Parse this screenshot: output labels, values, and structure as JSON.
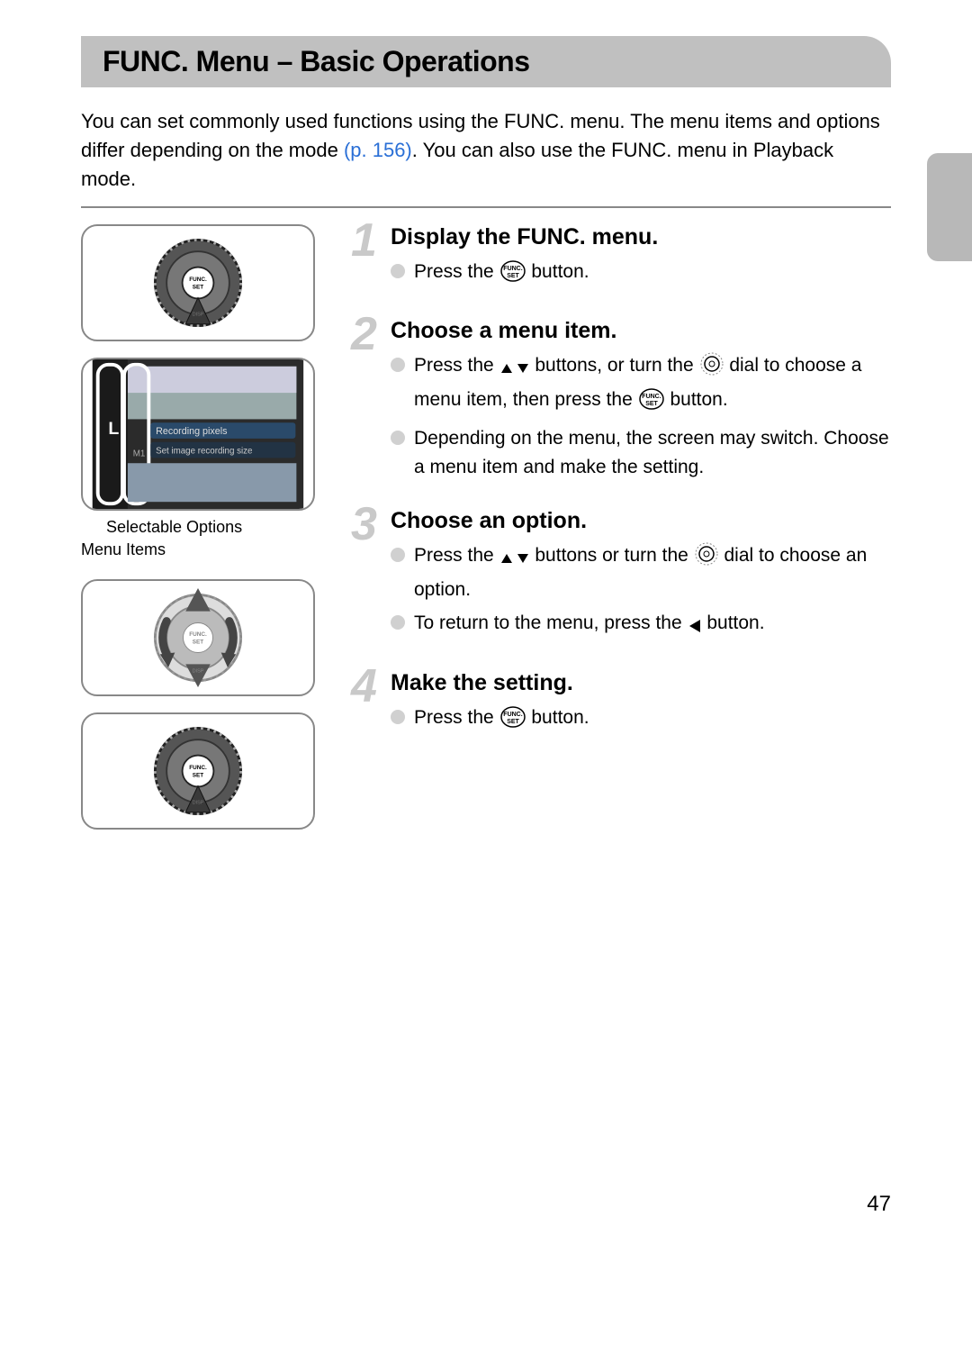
{
  "title": "FUNC. Menu – Basic Operations",
  "intro_before_ref": "You can set commonly used functions using the FUNC. menu. The menu items and options differ depending on the mode ",
  "page_ref": "(p. 156)",
  "intro_after_ref": ". You can also use the FUNC. menu in Playback mode.",
  "screen_labels": {
    "recording_pixels": "Recording pixels",
    "set_image_recording_size": "Set image recording size",
    "left_marker": "L",
    "m1": "M1"
  },
  "annotations": {
    "selectable_options": "Selectable Options",
    "menu_items": "Menu Items"
  },
  "steps": [
    {
      "num": "1",
      "title": "Display the FUNC. menu.",
      "bullets": [
        {
          "parts": [
            "Press the ",
            {
              "icon": "func-set"
            },
            " button."
          ]
        }
      ]
    },
    {
      "num": "2",
      "title": "Choose a menu item.",
      "bullets": [
        {
          "parts": [
            "Press the ",
            {
              "icon": "up-down"
            },
            " buttons, or turn the ",
            {
              "icon": "dial"
            },
            " dial to choose a menu item, then press the ",
            {
              "icon": "func-set"
            },
            " button."
          ]
        },
        {
          "parts": [
            "Depending on the menu, the screen may switch. Choose a menu item and make the setting."
          ]
        }
      ]
    },
    {
      "num": "3",
      "title": "Choose an option.",
      "bullets": [
        {
          "parts": [
            "Press the ",
            {
              "icon": "up-down"
            },
            " buttons or turn the ",
            {
              "icon": "dial"
            },
            " dial to choose an option."
          ]
        },
        {
          "parts": [
            "To return to the menu, press the ",
            {
              "icon": "left"
            },
            " button."
          ]
        }
      ]
    },
    {
      "num": "4",
      "title": "Make the setting.",
      "bullets": [
        {
          "parts": [
            "Press the ",
            {
              "icon": "func-set"
            },
            " button."
          ]
        }
      ]
    }
  ],
  "page_number": "47"
}
